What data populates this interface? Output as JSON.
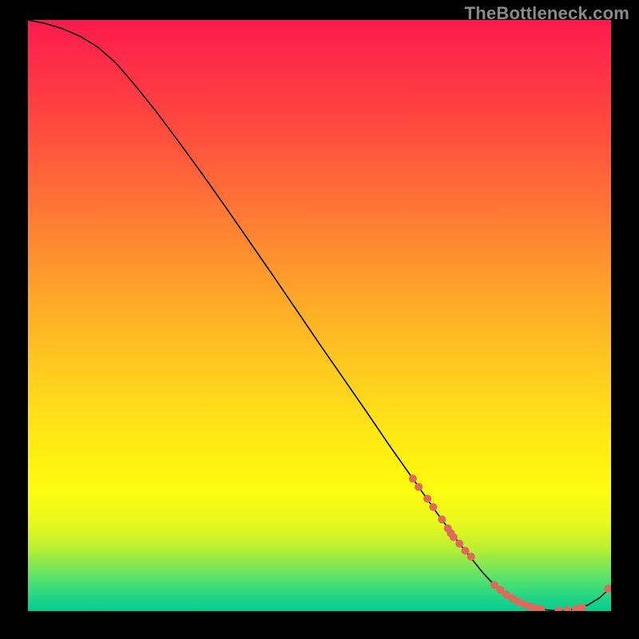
{
  "watermark": "TheBottleneck.com",
  "chart_data": {
    "type": "line",
    "title": "",
    "xlabel": "",
    "ylabel": "",
    "xlim": [
      0,
      100
    ],
    "ylim": [
      0,
      100
    ],
    "grid": false,
    "legend": false,
    "series": [
      {
        "name": "curve",
        "color": "#000000",
        "x": [
          0,
          3,
          6,
          9,
          12,
          15,
          18,
          22,
          26,
          30,
          34,
          38,
          42,
          46,
          50,
          54,
          58,
          62,
          66,
          70,
          74,
          78,
          80,
          82,
          84,
          86,
          88,
          90,
          92,
          94,
          96,
          98,
          100
        ],
        "y": [
          100,
          99.4,
          98.5,
          97.2,
          95.4,
          92.8,
          89.4,
          84.5,
          79.2,
          73.8,
          68.2,
          62.5,
          56.8,
          51.0,
          45.2,
          39.5,
          33.8,
          28.0,
          22.4,
          16.8,
          11.4,
          6.5,
          4.4,
          2.8,
          1.6,
          0.8,
          0.3,
          0.1,
          0.1,
          0.4,
          1.0,
          2.2,
          4.0
        ]
      }
    ],
    "points": {
      "name": "markers",
      "color": "#e06a5a",
      "radius_px": 5,
      "x": [
        66,
        67,
        68.5,
        69.5,
        71,
        72,
        72.5,
        73,
        74,
        75,
        76,
        80,
        81,
        82,
        83,
        84,
        85,
        86,
        87,
        88,
        91,
        92.5,
        94,
        95,
        99.5
      ],
      "y": [
        22.4,
        21.0,
        19.0,
        17.6,
        15.5,
        14.0,
        13.2,
        12.5,
        11.4,
        10.2,
        9.2,
        4.4,
        3.6,
        2.8,
        2.2,
        1.6,
        1.2,
        0.8,
        0.5,
        0.3,
        0.1,
        0.2,
        0.4,
        0.6,
        3.8
      ]
    }
  }
}
